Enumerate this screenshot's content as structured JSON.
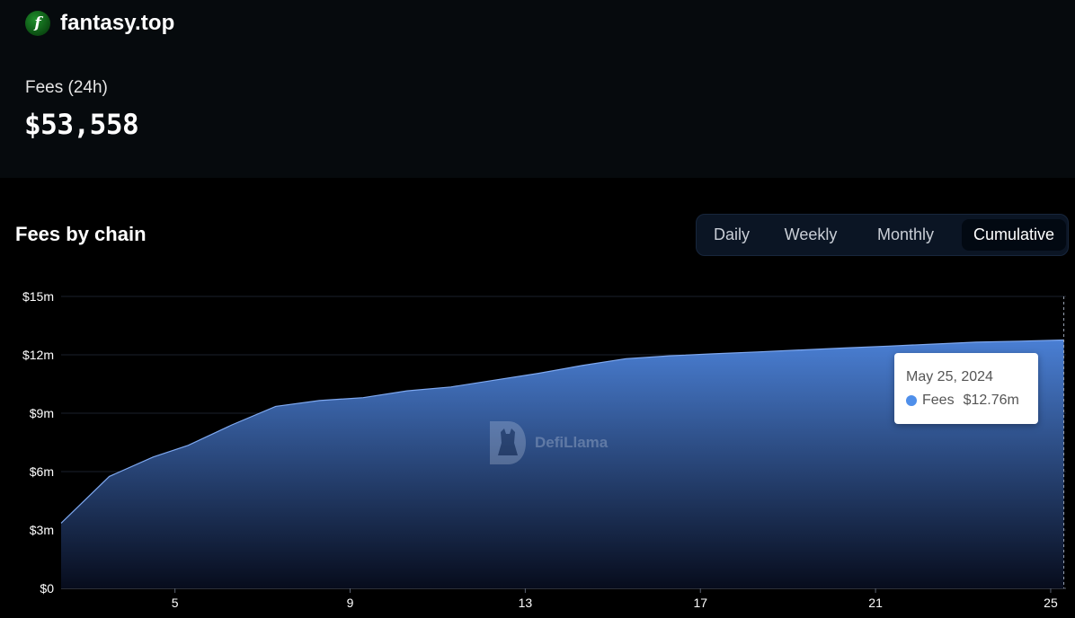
{
  "protocol": {
    "name": "fantasy.top",
    "logo_icon": "fantasy-top-logo-icon",
    "logo_letter": "f"
  },
  "stats": {
    "fees_label": "Fees (24h)",
    "fees_value": "$53,558"
  },
  "chart_section": {
    "title": "Fees by chain",
    "tabs": [
      {
        "label": "Daily",
        "active": false
      },
      {
        "label": "Weekly",
        "active": false
      },
      {
        "label": "Monthly",
        "active": false
      },
      {
        "label": "Cumulative",
        "active": true
      }
    ]
  },
  "tooltip": {
    "date": "May 25, 2024",
    "series": "Fees",
    "value": "$12.76m",
    "dot_color": "#4f8fea"
  },
  "watermark": {
    "text": "DefiLlama",
    "icon": "defillama-logo-icon"
  },
  "colors": {
    "background": "#000000",
    "top_panel": "#060a0d",
    "series_line": "#7ea8f0",
    "area_top": "#4a7fd4",
    "area_bottom": "#070c1c",
    "grid": "#1a1f2b"
  },
  "chart_data": {
    "type": "area",
    "title": "Fees by chain",
    "xlabel": "",
    "ylabel": "",
    "x_ticks": [
      "5",
      "9",
      "13",
      "17",
      "21",
      "25"
    ],
    "y_ticks": [
      "$0",
      "$3m",
      "$6m",
      "$9m",
      "$12m",
      "$15m"
    ],
    "xlim": [
      2.4,
      25.35
    ],
    "ylim": [
      0,
      15
    ],
    "grid": true,
    "legend": "none",
    "series": [
      {
        "name": "Fees",
        "x": [
          2.4,
          3.5,
          4.5,
          5.3,
          6.3,
          7.3,
          8.3,
          9.3,
          10.3,
          11.3,
          12.3,
          13.3,
          14.3,
          15.3,
          16.3,
          17.3,
          18.3,
          19.3,
          20.3,
          21.3,
          22.3,
          23.3,
          24.3,
          25.3
        ],
        "values": [
          3.35,
          5.75,
          6.75,
          7.35,
          8.4,
          9.35,
          9.65,
          9.8,
          10.15,
          10.35,
          10.7,
          11.05,
          11.45,
          11.8,
          11.95,
          12.05,
          12.15,
          12.25,
          12.35,
          12.45,
          12.55,
          12.65,
          12.7,
          12.76
        ]
      }
    ]
  }
}
